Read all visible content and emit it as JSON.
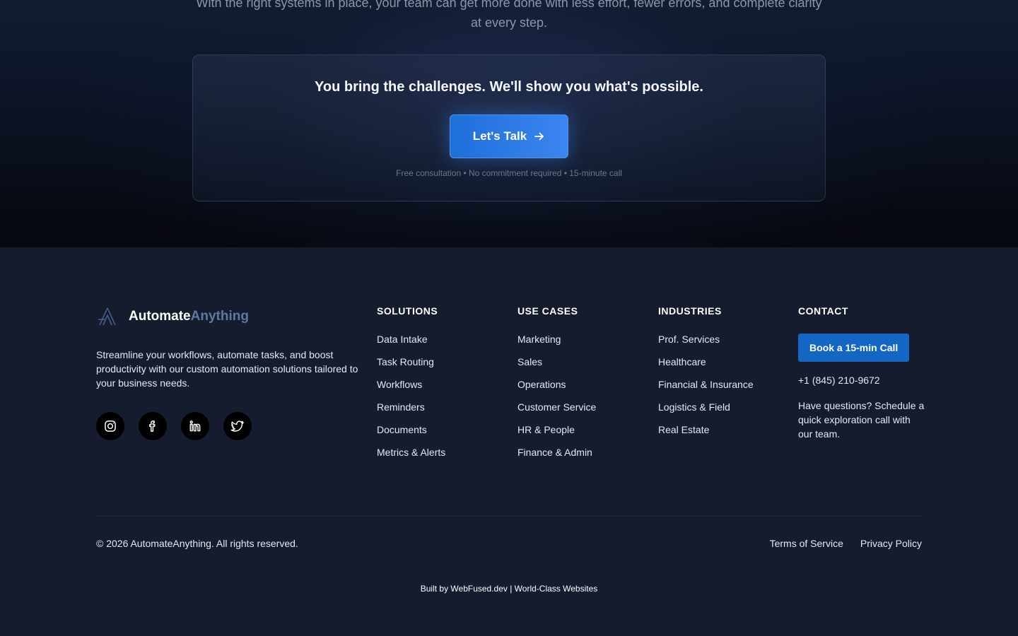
{
  "intro": {
    "line1": "With the right systems in place, your team can get more done with less effort, fewer errors, and complete clarity",
    "line2": "at every step."
  },
  "cta": {
    "headline": "You bring the challenges. We'll show you what's possible.",
    "button_label": "Let's Talk",
    "note": "Free consultation • No commitment required • 15-minute call"
  },
  "brand": {
    "name_part1": "Automate",
    "name_part2": "Anything",
    "description": "Streamline your workflows, automate tasks, and boost productivity with our custom automation solutions tailored to your business needs.",
    "socials": [
      "instagram-icon",
      "facebook-icon",
      "linkedin-icon",
      "twitter-icon"
    ]
  },
  "columns": {
    "solutions": {
      "title": "SOLUTIONS",
      "items": [
        "Data Intake",
        "Task Routing",
        "Workflows",
        "Reminders",
        "Documents",
        "Metrics & Alerts"
      ]
    },
    "use_cases": {
      "title": "USE CASES",
      "items": [
        "Marketing",
        "Sales",
        "Operations",
        "Customer Service",
        "HR & People",
        "Finance & Admin"
      ]
    },
    "industries": {
      "title": "INDUSTRIES",
      "items": [
        "Prof. Services",
        "Healthcare",
        "Financial & Insurance",
        "Logistics & Field",
        "Real Estate"
      ]
    }
  },
  "contact": {
    "title": "CONTACT",
    "button_label": "Book a 15-min Call",
    "phone": "+1 (845) 210-9672",
    "text": "Have questions? Schedule a quick exploration call with our team."
  },
  "bottom": {
    "copyright": "© 2026 AutomateAnything. All rights reserved.",
    "terms": "Terms of Service",
    "privacy": "Privacy Policy",
    "built_by": "Built by WebFused.dev | World-Class Websites"
  },
  "colors": {
    "accent": "#3b86f0",
    "book_button": "#1466c4",
    "footer_bg": "#141c2e"
  }
}
